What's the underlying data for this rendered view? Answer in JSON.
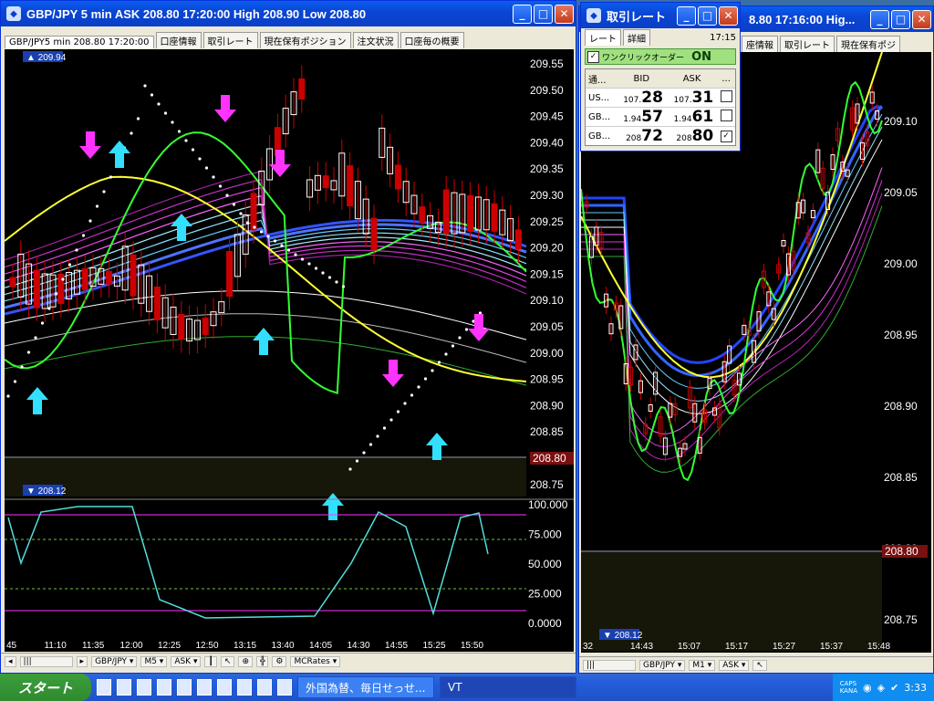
{
  "left_window": {
    "title": "GBP/JPY 5 min ASK 208.80 17:20:00 High 208.90 Low 208.80",
    "tabs": [
      "GBP/JPY5 min 208.80 17:20:00",
      "口座情報",
      "取引レート",
      "現在保有ポジション",
      "注文状況",
      "口座毎の概要"
    ],
    "price_labels": [
      "209.55",
      "209.50",
      "209.45",
      "209.40",
      "209.35",
      "209.30",
      "209.25",
      "209.20",
      "209.15",
      "209.10",
      "209.05",
      "209.00",
      "208.95",
      "208.90",
      "208.85",
      "208.80",
      "208.75"
    ],
    "current_price": "208.80",
    "high_marker": "209.94",
    "low_marker": "208.12",
    "osc_labels": [
      "100.000",
      "75.000",
      "50.000",
      "25.000",
      "0.0000"
    ],
    "time_labels": [
      "45",
      "11:10",
      "11:35",
      "12:00",
      "12:25",
      "12:50",
      "13:15",
      "13:40",
      "14:05",
      "14:30",
      "14:55",
      "15:25",
      "15:50"
    ],
    "toolbar": {
      "symbol": "GBP/JPY ▾",
      "tf": "M5 ▾",
      "side": "ASK ▾",
      "mcrates": "MCRates ▾"
    }
  },
  "right_window": {
    "title": "8.80 17:16:00 Hig...",
    "tabs": [
      "座情報",
      "取引レート",
      "現在保有ポジ"
    ],
    "price_labels": [
      "209.10",
      "209.05",
      "209.00",
      "208.95",
      "208.90",
      "208.85",
      "208.80",
      "208.75"
    ],
    "current_price": "208.80",
    "low_marker": "208.12",
    "time_labels": [
      "32",
      "14:43",
      "15:07",
      "15:17",
      "15:27",
      "15:37",
      "15:48"
    ],
    "toolbar": {
      "symbol": "GBP/JPY ▾",
      "tf": "M1 ▾",
      "side": "ASK ▾"
    }
  },
  "rate_window": {
    "title": "取引レート",
    "tabs": [
      "レート",
      "詳細"
    ],
    "time": "17:15",
    "one_click_label": "ワンクリックオーダー",
    "one_click_state": "ON",
    "headers": [
      "通...",
      "BID",
      "ASK",
      "..."
    ],
    "rows": [
      {
        "sym": "US...",
        "bid_small": "107.",
        "bid_big": "28",
        "ask_small": "107.",
        "ask_big": "31",
        "checked": false
      },
      {
        "sym": "GB...",
        "bid_small": "1.94",
        "bid_big": "57",
        "ask_small": "1.94",
        "ask_big": "61",
        "checked": false
      },
      {
        "sym": "GB...",
        "bid_small": "208",
        "bid_big": "72",
        "ask_small": "208",
        "ask_big": "80",
        "checked": true
      }
    ]
  },
  "taskbar": {
    "start_label": "スタート",
    "items": [
      "外国為替、毎日せっせ...",
      "VT"
    ],
    "tray_caps": "CAPS",
    "tray_kana": "KANA",
    "clock": "3:33"
  }
}
